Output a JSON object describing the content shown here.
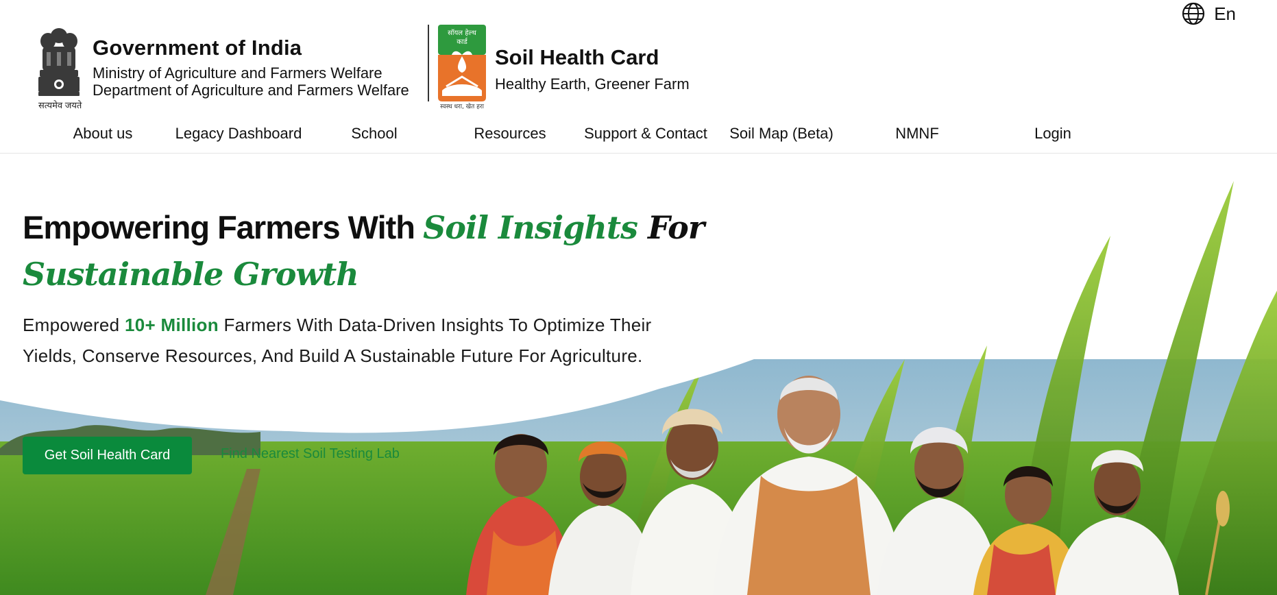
{
  "header": {
    "language": "En",
    "gov_title": "Government of India",
    "ministry": "Ministry of Agriculture and Farmers Welfare",
    "department": "Department of Agriculture and Farmers Welfare",
    "emblem_motto": "सत्यमेव जयते",
    "shc_logo_text_top": "सॉयल हेल्थ",
    "shc_logo_text_mid": "कार्ड",
    "shc_logo_text_bottom": "स्वस्थ धरा, खेत हरा",
    "shc_title": "Soil Health Card",
    "shc_tagline": "Healthy Earth, Greener Farm"
  },
  "nav": {
    "items": [
      {
        "label": "About us"
      },
      {
        "label": "Legacy Dashboard"
      },
      {
        "label": "School"
      },
      {
        "label": "Resources"
      },
      {
        "label": "Support & Contact"
      },
      {
        "label": "Soil Map (Beta)"
      },
      {
        "label": "NMNF"
      },
      {
        "label": "Login"
      }
    ]
  },
  "hero": {
    "headline_part1": "Empowering Farmers With ",
    "headline_part2": "Soil Insights",
    "headline_part3": " For",
    "headline_line2": "Sustainable Growth",
    "desc_prefix": "Empowered ",
    "desc_highlight": "10+ Million",
    "desc_rest": " Farmers With Data-Driven Insights To Optimize Their Yields, Conserve Resources, And Build A Sustainable Future For Agriculture.",
    "primary_button": "Get Soil Health Card",
    "secondary_link": "Find Nearest Soil Testing Lab"
  },
  "colors": {
    "brand_green": "#0a8a3c",
    "accent_green": "#1a8a3c",
    "logo_green": "#2e9a3e",
    "logo_orange": "#e8732a"
  },
  "icons": {
    "language": "globe-icon"
  }
}
